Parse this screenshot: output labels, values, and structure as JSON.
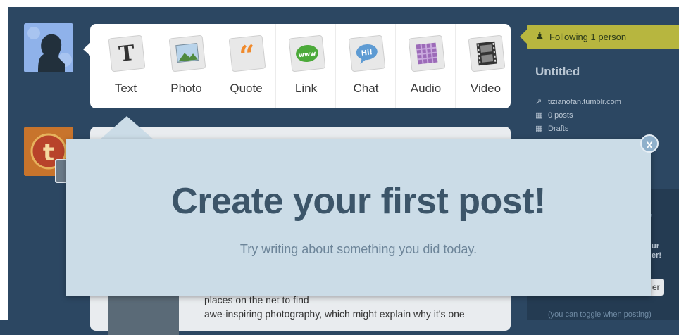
{
  "post_types": [
    {
      "label": "Text",
      "icon": "text-icon",
      "glyph": "T",
      "color": "#444444"
    },
    {
      "label": "Photo",
      "icon": "photo-icon",
      "glyph": "",
      "color": "#9bb8d2"
    },
    {
      "label": "Quote",
      "icon": "quote-icon",
      "glyph": "“",
      "color": "#f08a2c"
    },
    {
      "label": "Link",
      "icon": "link-icon",
      "glyph": "www",
      "color": "#4caa3a"
    },
    {
      "label": "Chat",
      "icon": "chat-icon",
      "glyph": "Hi!",
      "color": "#5e9bd3"
    },
    {
      "label": "Audio",
      "icon": "audio-icon",
      "glyph": "",
      "color": "#9c6bb8"
    },
    {
      "label": "Video",
      "icon": "video-icon",
      "glyph": "",
      "color": "#555555"
    }
  ],
  "sidebar": {
    "following_label": "Following 1 person",
    "blog_title": "Untitled",
    "lines": [
      {
        "label": "tizianofan.tumblr.com",
        "icon": "external-link-icon"
      },
      {
        "label": "0 posts",
        "icon": "document-icon"
      },
      {
        "label": "Drafts",
        "icon": "document-icon"
      }
    ],
    "toggle_note": "(you can toggle when posting)"
  },
  "feed": {
    "line1": "places on the net to find",
    "line2": "awe-inspiring photography, which might explain why it's one"
  },
  "overlay": {
    "headline": "Create your first post!",
    "subtext": "Try writing about something you did today.",
    "close_label": "X"
  },
  "colors": {
    "dashboard_bg": "#2c4762",
    "overlay_bg": "#cbdce7",
    "following_badge": "#b7b63f"
  }
}
